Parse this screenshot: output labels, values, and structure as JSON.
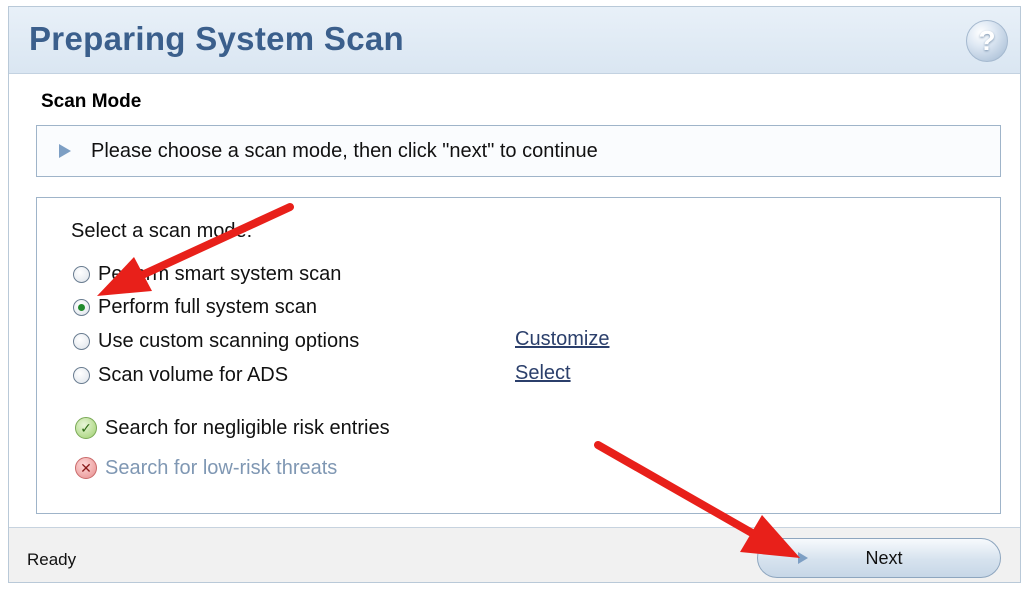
{
  "header": {
    "title": "Preparing System Scan",
    "help_icon": "question-mark-icon",
    "help_glyph": "?"
  },
  "section": {
    "title": "Scan Mode"
  },
  "info": {
    "text": "Please choose a scan mode, then click \"next\" to continue"
  },
  "scan_options": {
    "label": "Select a scan mode:",
    "modes": [
      {
        "label": "Perform smart system scan",
        "checked": false
      },
      {
        "label": "Perform full system scan",
        "checked": true
      },
      {
        "label": "Use custom scanning options",
        "checked": false,
        "link": "Customize"
      },
      {
        "label": "Scan volume for ADS",
        "checked": false,
        "link": "Select"
      }
    ],
    "flags": [
      {
        "label": "Search for negligible risk entries",
        "state": "enabled",
        "icon": "green-check-icon",
        "glyph": "✓"
      },
      {
        "label": "Search for low-risk threats",
        "state": "disabled",
        "icon": "red-x-icon",
        "glyph": "✕"
      }
    ]
  },
  "footer": {
    "status": "Ready",
    "next_label": "Next"
  },
  "colors": {
    "title": "#3b5f8c",
    "accent": "#7d9fc4",
    "annotation_arrow": "#e8201a"
  }
}
